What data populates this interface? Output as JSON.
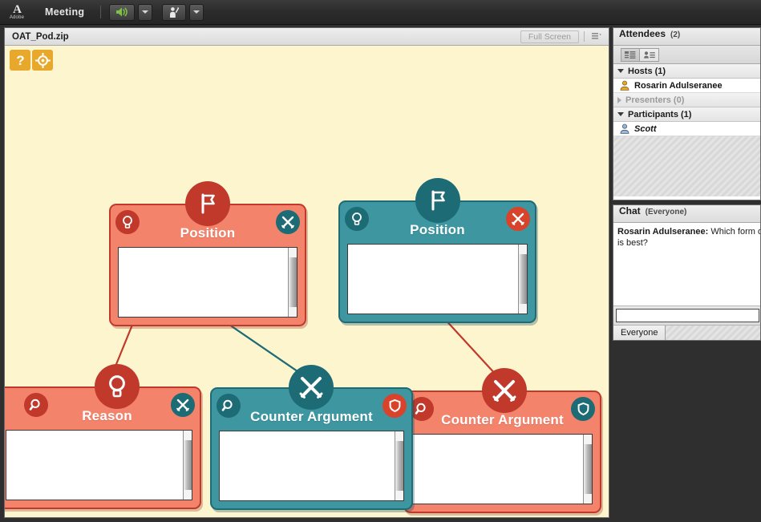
{
  "app": {
    "brand": "Adobe",
    "brand_mark": "A",
    "menu": [
      "Meeting"
    ],
    "toolbar": {
      "speaker_icon": "speaker-icon",
      "speaker_caret_icon": "chevron-down-icon",
      "raise_hand_icon": "raise-hand-icon",
      "raise_hand_caret_icon": "chevron-down-icon"
    }
  },
  "share_pod": {
    "title": "OAT_Pod.zip",
    "fullscreen_label": "Full Screen",
    "pod_menu_icon": "pod-options-icon",
    "canvas_tools": [
      {
        "name": "help-tool",
        "icon": "question-mark-icon",
        "glyph": "?"
      },
      {
        "name": "target-tool",
        "icon": "target-icon",
        "glyph": "⊕"
      }
    ],
    "nodes": [
      {
        "id": "position-left",
        "title": "Position",
        "color": "salmon",
        "badge_icon": "flag-icon",
        "left_icon": "lightbulb-icon",
        "right_icon": "crossed-swords-icon",
        "field_value": ""
      },
      {
        "id": "position-right",
        "title": "Position",
        "color": "teal",
        "badge_icon": "flag-icon",
        "left_icon": "lightbulb-icon",
        "right_icon": "crossed-swords-icon",
        "field_value": ""
      },
      {
        "id": "reason",
        "title": "Reason",
        "color": "salmon",
        "badge_icon": "lightbulb-icon",
        "left_icon": "magnifier-icon",
        "right_icon": "crossed-swords-icon",
        "field_value": ""
      },
      {
        "id": "counter-argument-center",
        "title": "Counter Argument",
        "color": "teal",
        "badge_icon": "crossed-swords-icon",
        "left_icon": "magnifier-icon",
        "right_icon": "shield-icon",
        "field_value": ""
      },
      {
        "id": "counter-argument-right",
        "title": "Counter Argument",
        "color": "salmon",
        "badge_icon": "crossed-swords-icon",
        "left_icon": "magnifier-icon",
        "right_icon": "shield-icon",
        "field_value": ""
      }
    ]
  },
  "attendees": {
    "title": "Attendees",
    "count_label": "(2)",
    "view_buttons": [
      {
        "name": "list-view-button",
        "icon": "list-view-icon"
      },
      {
        "name": "detail-view-button",
        "icon": "card-view-icon"
      }
    ],
    "groups": [
      {
        "label": "Hosts (1)",
        "expanded": true,
        "members": [
          {
            "name": "Rosarin Adulseranee",
            "icon": "host-avatar-icon",
            "italic": false
          }
        ]
      },
      {
        "label": "Presenters (0)",
        "expanded": false,
        "members": []
      },
      {
        "label": "Participants (1)",
        "expanded": true,
        "members": [
          {
            "name": "Scott",
            "icon": "participant-avatar-icon",
            "italic": true
          }
        ]
      }
    ]
  },
  "chat": {
    "title": "Chat",
    "scope_label": "(Everyone)",
    "messages": [
      {
        "sender": "Rosarin Adulseranee:",
        "text_line1": " Which form of alterr",
        "text_line2": "is best?"
      }
    ],
    "input_value": "",
    "input_placeholder": "",
    "tabs": [
      {
        "label": "Everyone",
        "active": true
      }
    ]
  },
  "colors": {
    "canvas_bg": "#fdf5ce",
    "salmon": "#f4836c",
    "salmon_dark": "#c0392b",
    "teal": "#3d96a0",
    "teal_dark": "#1d6b74",
    "tool_orange": "#e8a82c"
  }
}
